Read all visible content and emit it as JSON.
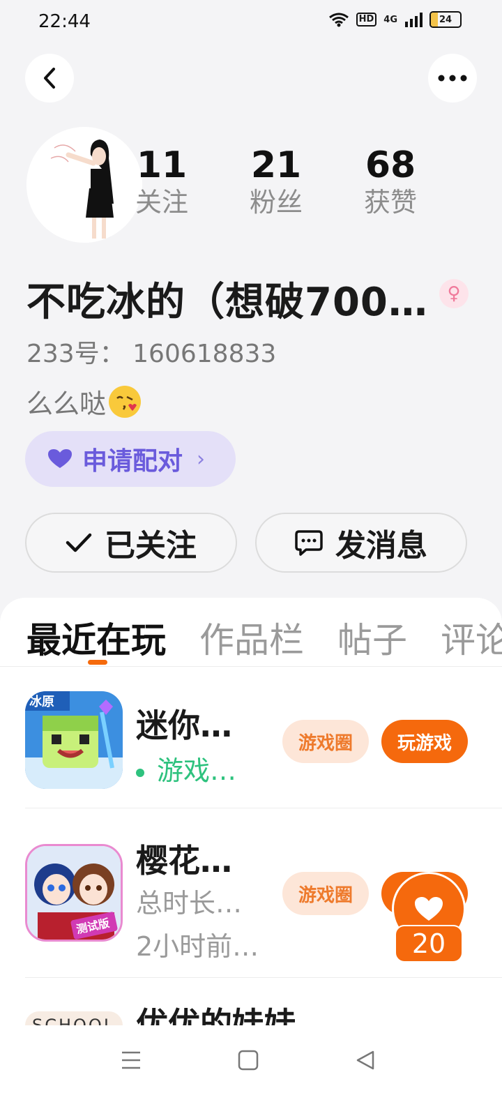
{
  "status_bar": {
    "time": "22:44",
    "hd": "HD",
    "network": "4G",
    "battery": "24",
    "battery_level": 0.24
  },
  "profile": {
    "following_count": "11",
    "following_label": "关注",
    "fans_count": "21",
    "fans_label": "粉丝",
    "likes_count": "68",
    "likes_label": "获赞",
    "name": "不吃冰的（想破700…",
    "gender_icon": "female-icon",
    "id_text": "233号：  160618833",
    "bio": "么么哒"
  },
  "pair_button": {
    "label": "申请配对",
    "chevron": "›"
  },
  "actions": {
    "follow_label": "已关注",
    "message_label": "发消息"
  },
  "tabs": [
    "最近在玩",
    "作品栏",
    "帖子",
    "评论"
  ],
  "games": [
    {
      "title": "迷你…",
      "sub": "游戏…",
      "circle_label": "游戏圈",
      "play_label": "玩游戏",
      "icon_text": "冰原"
    },
    {
      "title": "樱花…",
      "sub": "总时长…",
      "sub2": "2小时前…",
      "circle_label": "游戏圈",
      "icon_text": "测试版"
    },
    {
      "title": "优优的娃娃",
      "icon_text": "SCHOOL"
    }
  ],
  "like_float": {
    "count": "20"
  },
  "colors": {
    "accent": "#f5690d",
    "pair": "#6a5bdc",
    "online": "#2ec27e",
    "background": "#f4f4f6"
  }
}
